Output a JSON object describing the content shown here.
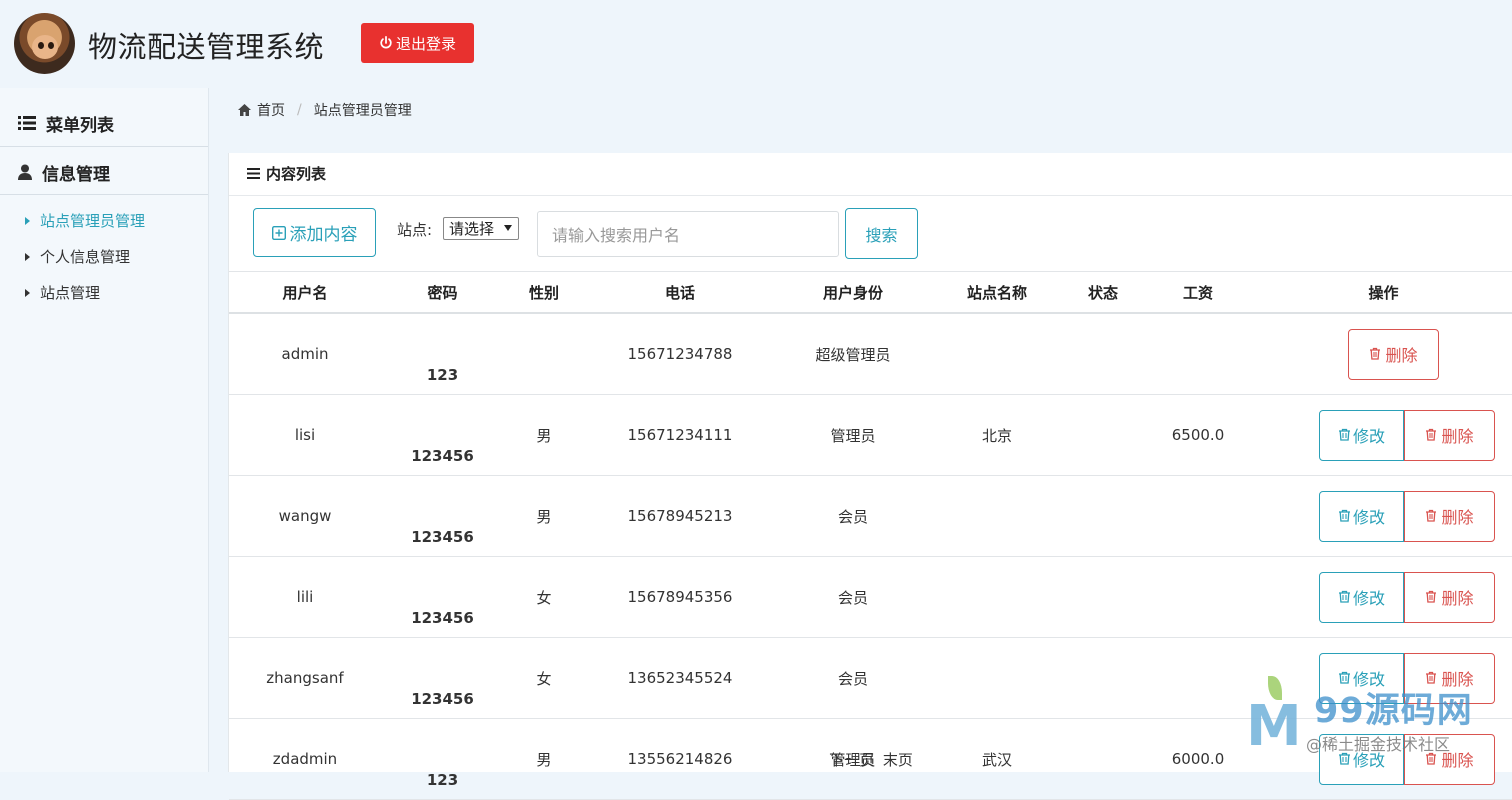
{
  "app": {
    "title": "物流配送管理系统",
    "logout_label": "退出登录"
  },
  "sidebar": {
    "menu_title": "菜单列表",
    "group_title": "信息管理",
    "items": [
      {
        "label": "站点管理员管理",
        "active": true
      },
      {
        "label": "个人信息管理",
        "active": false
      },
      {
        "label": "站点管理",
        "active": false
      }
    ]
  },
  "breadcrumb": {
    "home": "首页",
    "current": "站点管理员管理"
  },
  "panel": {
    "title": "内容列表",
    "add_label": "添加内容",
    "station_label": "站点:",
    "station_select": "请选择",
    "search_placeholder": "请输入搜索用户名",
    "search_label": "搜索",
    "columns": [
      "用户名",
      "密码",
      "性别",
      "电话",
      "用户身份",
      "站点名称",
      "状态",
      "工资",
      "操作"
    ],
    "rows": [
      {
        "username": "admin",
        "password": "123",
        "gender": "",
        "phone": "15671234788",
        "role": "超级管理员",
        "station": "",
        "status": "",
        "salary": "",
        "editable": false
      },
      {
        "username": "lisi",
        "password": "123456",
        "gender": "男",
        "phone": "15671234111",
        "role": "管理员",
        "station": "北京",
        "status": "",
        "salary": "6500.0",
        "editable": true
      },
      {
        "username": "wangw",
        "password": "123456",
        "gender": "男",
        "phone": "15678945213",
        "role": "会员",
        "station": "",
        "status": "",
        "salary": "",
        "editable": true
      },
      {
        "username": "lili",
        "password": "123456",
        "gender": "女",
        "phone": "15678945356",
        "role": "会员",
        "station": "",
        "status": "",
        "salary": "",
        "editable": true
      },
      {
        "username": "zhangsanf",
        "password": "123456",
        "gender": "女",
        "phone": "13652345524",
        "role": "会员",
        "station": "",
        "status": "",
        "salary": "",
        "editable": true
      },
      {
        "username": "zdadmin",
        "password": "123",
        "gender": "男",
        "phone": "13556214826",
        "role": "管理员",
        "station": "武汉",
        "status": "",
        "salary": "6000.0",
        "editable": true
      }
    ],
    "edit_label": "修改",
    "delete_label": "删除",
    "pager": {
      "next": "下一页",
      "last": "末页"
    }
  },
  "watermark": {
    "brand": "99源码网",
    "sub": "@稀土掘金技术社区"
  },
  "colors": {
    "accent": "#2aa0b8",
    "danger": "#d9534f",
    "logout": "#e8312f"
  }
}
